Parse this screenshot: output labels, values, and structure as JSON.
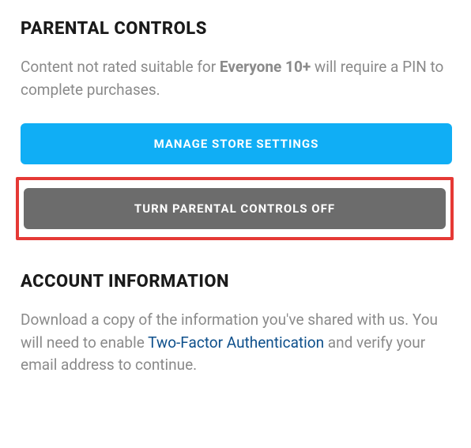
{
  "parental": {
    "title": "PARENTAL CONTROLS",
    "desc_pre": "Content not rated suitable for ",
    "desc_bold": "Everyone 10+",
    "desc_post": " will require a PIN to complete purchases.",
    "manage_label": "MANAGE STORE SETTINGS",
    "turnoff_label": "TURN PARENTAL CONTROLS OFF"
  },
  "account": {
    "title": "ACCOUNT INFORMATION",
    "desc_pre": "Download a copy of the information you've shared with us. You will need to enable ",
    "link_label": "Two-Factor Authentication",
    "desc_post": " and verify your email address to continue."
  }
}
